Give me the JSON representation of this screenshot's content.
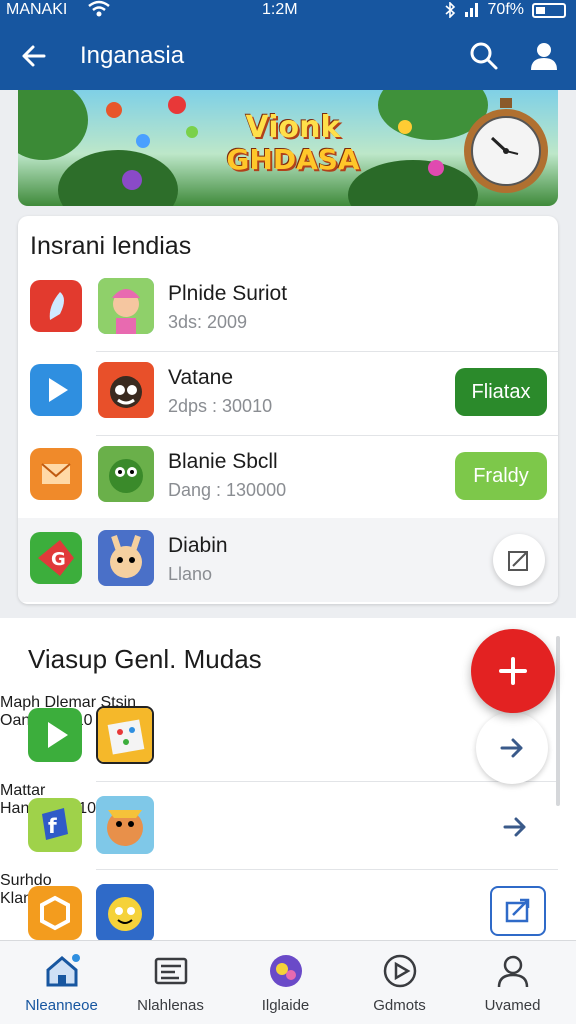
{
  "status_bar": {
    "carrier": "MANAKI",
    "time": "1:2M",
    "battery": "70f%"
  },
  "app_bar": {
    "title": "Inganasia"
  },
  "banner": {
    "logo_line1": "Vionk",
    "logo_line2": "GHDASA"
  },
  "featured": {
    "heading": "Insrani lendias",
    "items": [
      {
        "name": "Plnide Suriot",
        "meta": "3ds: 2009",
        "category_icon": "feather-icon",
        "category_color": "#e23a2e",
        "action": null
      },
      {
        "name": "Vatane",
        "meta": "2dps : 30010",
        "category_icon": "play-icon",
        "category_color": "#2f8fe0",
        "action": {
          "type": "pill",
          "label": "Fliatax",
          "color": "#2b8a2b"
        }
      },
      {
        "name": "Blanie Sbcll",
        "meta": "Dang : 130000",
        "category_icon": "envelope-icon",
        "category_color": "#f08a2a",
        "action": {
          "type": "pill",
          "label": "Fraldy",
          "color": "#7dc84a"
        }
      },
      {
        "name": "Diabin",
        "meta": "Llano",
        "category_icon": "g-logo-icon",
        "category_color": "#e03a3a",
        "action": {
          "type": "circle",
          "icon": "edit-icon"
        }
      }
    ]
  },
  "section2": {
    "heading": "Viasup Genl. Mudas",
    "items": [
      {
        "name": "Maph Dlemar Stsin",
        "meta": "Oang : 15f10",
        "category_icon": "play-icon",
        "category_color": "#3cae3c",
        "action": {
          "type": "circle",
          "icon": "arrow-right-icon"
        }
      },
      {
        "name": "Mattar",
        "meta": "Hanp : 190100",
        "category_icon": "f-logo-icon",
        "category_color": "#9fd24a",
        "action": {
          "type": "arrow",
          "icon": "arrow-right-icon"
        }
      },
      {
        "name": "Surhdo",
        "meta": "Klano",
        "category_icon": "hexagon-icon",
        "category_color": "#f39c1e",
        "action": {
          "type": "box",
          "icon": "export-icon"
        }
      }
    ]
  },
  "fab": {
    "icon": "plus-icon",
    "color": "#e32222"
  },
  "bottom_nav": [
    {
      "label": "Nleanneoe",
      "icon": "home-icon",
      "active": true
    },
    {
      "label": "Nlahlenas",
      "icon": "list-icon",
      "active": false
    },
    {
      "label": "Ilglaide",
      "icon": "game-icon",
      "active": false
    },
    {
      "label": "Gdmots",
      "icon": "play-circle-icon",
      "active": false
    },
    {
      "label": "Uvamed",
      "icon": "user-icon",
      "active": false
    }
  ],
  "colors": {
    "primary": "#1756a0",
    "accent_red": "#e32222",
    "green_dark": "#2b8a2b",
    "green_light": "#7dc84a"
  }
}
